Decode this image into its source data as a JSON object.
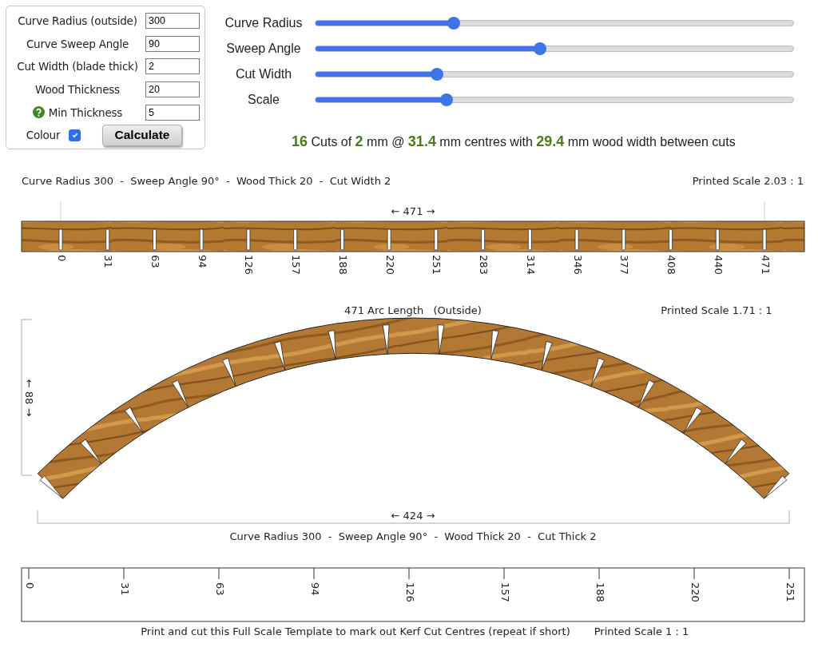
{
  "inputs": [
    {
      "kind": "plain",
      "label": "Curve Radius (outside)",
      "value": "300"
    },
    {
      "kind": "plain",
      "label": "Curve Sweep Angle",
      "value": "90"
    },
    {
      "kind": "plain",
      "label": "Cut Width (blade thick)",
      "value": "2"
    },
    {
      "kind": "plain",
      "label": "Wood Thickness",
      "value": "20"
    },
    {
      "kind": "help",
      "label": "Min Thickness",
      "value": "5"
    }
  ],
  "colour": {
    "label": "Colour",
    "checked": true
  },
  "calculate": "Calculate",
  "sliders": [
    {
      "label": "Curve Radius",
      "level": 0.29
    },
    {
      "label": "Sweep Angle",
      "level": 0.47
    },
    {
      "label": "Cut Width",
      "level": 0.255
    },
    {
      "label": "Scale",
      "level": 0.275
    }
  ],
  "result": "**16** Cuts of **2** mm @ **31.4** mm centres with **29.4** mm wood width between cuts",
  "board": {
    "caption": "Curve Radius 300  -  Sweep Angle 90°  -  Wood Thick 20  -  Cut Width 2",
    "scale": "Printed Scale 2.03 : 1",
    "length": "← 471 →",
    "marks": [
      "0",
      "31",
      "63",
      "94",
      "126",
      "157",
      "188",
      "220",
      "251",
      "283",
      "314",
      "346",
      "377",
      "408",
      "440",
      "471"
    ]
  },
  "arc": {
    "title": "471 Arc Length   (Outside)",
    "scale": "Printed Scale 1.71 : 1",
    "height": "← 88 →",
    "width": "← 424 →",
    "caption": "Curve Radius 300  -  Sweep Angle 90°  -  Wood Thick 20  -  Cut Thick 2"
  },
  "template": {
    "marks": [
      "0",
      "31",
      "63",
      "94",
      "126",
      "157",
      "188",
      "220",
      "251"
    ],
    "caption": "Print and cut this Full Scale Template to mark out Kerf Cut Centres (repeat if short)",
    "scale": "Printed Scale 1 : 1"
  }
}
